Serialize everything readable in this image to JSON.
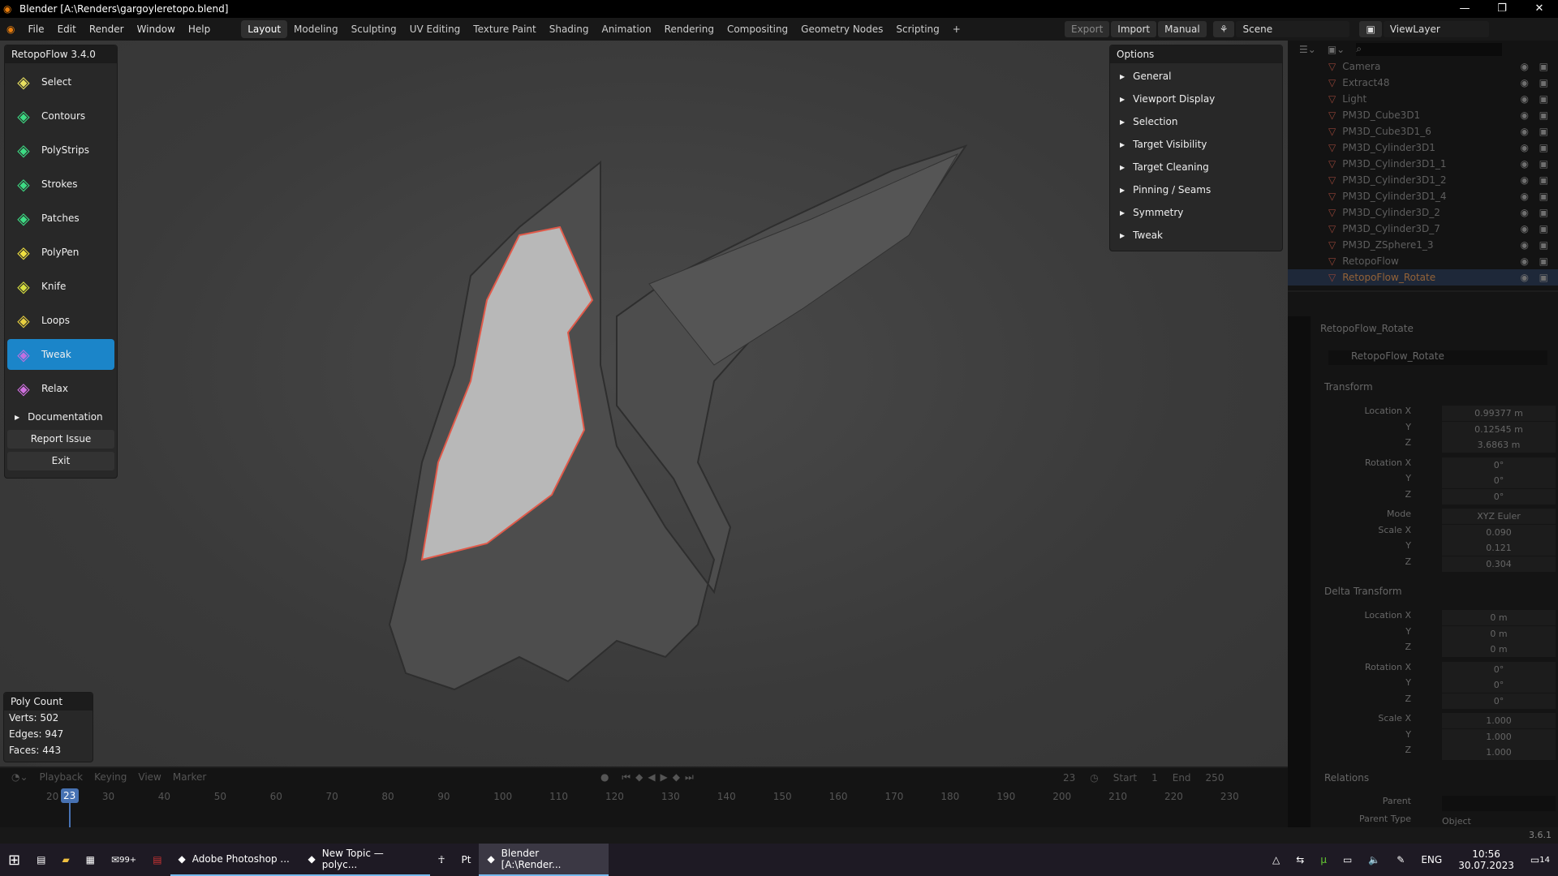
{
  "window": {
    "title": "Blender [A:\\Renders\\gargoyleretopo.blend]",
    "minimize": "—",
    "maximize": "❐",
    "close": "✕"
  },
  "menu": [
    "File",
    "Edit",
    "Render",
    "Window",
    "Help"
  ],
  "workspaces": [
    "Layout",
    "Modeling",
    "Sculpting",
    "UV Editing",
    "Texture Paint",
    "Shading",
    "Animation",
    "Rendering",
    "Compositing",
    "Geometry Nodes",
    "Scripting",
    "+"
  ],
  "active_workspace": "Layout",
  "header_right": {
    "export": "Export",
    "import": "Import",
    "manual": "Manual",
    "scene": "Scene",
    "view_layer": "ViewLayer"
  },
  "retopoflow": {
    "title": "RetopoFlow 3.4.0",
    "tools": [
      {
        "label": "Select",
        "icon": "select-icon",
        "color": "#e8e060"
      },
      {
        "label": "Contours",
        "icon": "contours-icon",
        "color": "#3ddc84"
      },
      {
        "label": "PolyStrips",
        "icon": "polystrips-icon",
        "color": "#3ddc84"
      },
      {
        "label": "Strokes",
        "icon": "strokes-icon",
        "color": "#3ddc84"
      },
      {
        "label": "Patches",
        "icon": "patches-icon",
        "color": "#3ddc84"
      },
      {
        "label": "PolyPen",
        "icon": "polypen-icon",
        "color": "#f0e040"
      },
      {
        "label": "Knife",
        "icon": "knife-icon",
        "color": "#d8e040"
      },
      {
        "label": "Loops",
        "icon": "loops-icon",
        "color": "#e8d040"
      },
      {
        "label": "Tweak",
        "icon": "tweak-icon",
        "color": "#c070e0"
      },
      {
        "label": "Relax",
        "icon": "relax-icon",
        "color": "#d070e0"
      }
    ],
    "active_tool": "Tweak",
    "documentation": "Documentation",
    "report_issue": "Report Issue",
    "exit": "Exit"
  },
  "options": {
    "title": "Options",
    "items": [
      "General",
      "Viewport Display",
      "Selection",
      "Target Visibility",
      "Target Cleaning",
      "Pinning / Seams",
      "Symmetry",
      "Tweak"
    ]
  },
  "poly_count": {
    "title": "Poly Count",
    "verts": "Verts:  502",
    "edges": "Edges: 947",
    "faces": "Faces: 443"
  },
  "outliner": {
    "items": [
      "Camera",
      "Extract48",
      "Light",
      "PM3D_Cube3D1",
      "PM3D_Cube3D1_6",
      "PM3D_Cylinder3D1",
      "PM3D_Cylinder3D1_1",
      "PM3D_Cylinder3D1_2",
      "PM3D_Cylinder3D1_4",
      "PM3D_Cylinder3D_2",
      "PM3D_Cylinder3D_7",
      "PM3D_ZSphere1_3",
      "RetopoFlow",
      "RetopoFlow_Rotate"
    ],
    "selected": "RetopoFlow_Rotate"
  },
  "properties": {
    "object_name": "RetopoFlow_Rotate",
    "data_name": "RetopoFlow_Rotate",
    "transform": "Transform",
    "delta_transform": "Delta Transform",
    "relations": "Relations",
    "rows": [
      [
        "Location X",
        "0.99377 m"
      ],
      [
        "Y",
        "0.12545 m"
      ],
      [
        "Z",
        "3.6863 m"
      ],
      [
        "Rotation X",
        "0°"
      ],
      [
        "Y",
        "0°"
      ],
      [
        "Z",
        "0°"
      ],
      [
        "Mode",
        "XYZ Euler"
      ],
      [
        "Scale X",
        "0.090"
      ],
      [
        "Y",
        "0.121"
      ],
      [
        "Z",
        "0.304"
      ]
    ],
    "delta_rows": [
      [
        "Location X",
        "0 m"
      ],
      [
        "Y",
        "0 m"
      ],
      [
        "Z",
        "0 m"
      ],
      [
        "Rotation X",
        "0°"
      ],
      [
        "Y",
        "0°"
      ],
      [
        "Z",
        "0°"
      ],
      [
        "Scale X",
        "1.000"
      ],
      [
        "Y",
        "1.000"
      ],
      [
        "Z",
        "1.000"
      ]
    ],
    "parent_label": "Parent",
    "parent_type_label": "Parent Type",
    "parent_type": "Object"
  },
  "timeline": {
    "menus": [
      "Playback",
      "Keying",
      "View",
      "Marker"
    ],
    "current_frame": "23",
    "start_label": "Start",
    "start": "1",
    "end_label": "End",
    "end": "250",
    "ticks": [
      "20",
      "30",
      "40",
      "50",
      "60",
      "70",
      "80",
      "90",
      "100",
      "110",
      "120",
      "130",
      "140",
      "150",
      "160",
      "170",
      "180",
      "190",
      "200",
      "210",
      "220",
      "230"
    ]
  },
  "status": {
    "version": "3.6.1"
  },
  "taskbar": {
    "apps": [
      {
        "label": "Adobe Photoshop ...",
        "icon": "photoshop-icon"
      },
      {
        "label": "New Topic — polyc...",
        "icon": "firefox-icon"
      },
      {
        "label": "Blender [A:\\Render...",
        "icon": "blender-icon"
      }
    ],
    "mail_badge": "99+",
    "lang": "ENG",
    "time": "10:56",
    "date": "30.07.2023",
    "notifications": "14"
  }
}
